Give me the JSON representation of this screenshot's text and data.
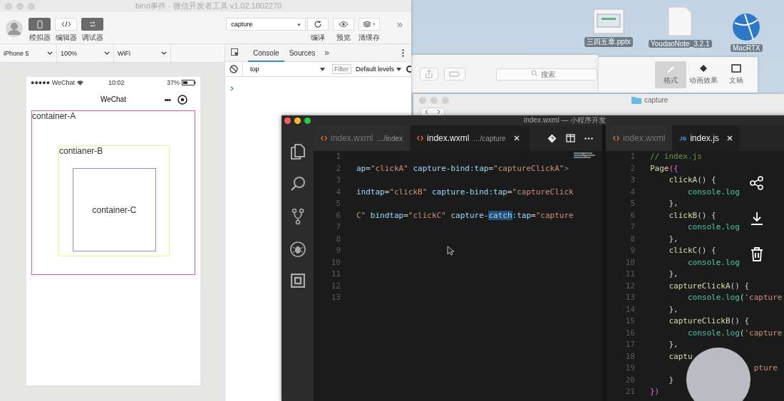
{
  "desktop": {
    "icons": [
      {
        "label": "三四五章.pptx",
        "kind": "slides"
      },
      {
        "label": "YoudaoNote_3.2.1",
        "kind": "document"
      },
      {
        "label": "MacRTX",
        "kind": "globe"
      }
    ]
  },
  "background_windows": {
    "search_placeholder": "搜索",
    "tools": [
      {
        "label": "格式",
        "kind": "brush",
        "selected": true
      },
      {
        "label": "动画效果",
        "kind": "diamond",
        "selected": false
      },
      {
        "label": "文稿",
        "kind": "doc",
        "selected": false
      }
    ],
    "finder_title": "capture"
  },
  "devtools": {
    "title": "bind事件 - 微信开发者工具 v1.02.1802270",
    "modes": [
      {
        "label": "模拟器",
        "kind": "phone",
        "selected": true
      },
      {
        "label": "编辑器",
        "kind": "code",
        "selected": false
      },
      {
        "label": "调试器",
        "kind": "debug",
        "selected": true
      }
    ],
    "project": "capture",
    "actions": [
      {
        "label": "编译",
        "kind": "refresh"
      },
      {
        "label": "预览",
        "kind": "eye"
      },
      {
        "label": "清缓存",
        "kind": "layers"
      }
    ],
    "more": "»",
    "device_selects": [
      "iPhone 5",
      "100%",
      "WiFi"
    ],
    "debugger": {
      "tabs": [
        {
          "label": "Console",
          "selected": true
        },
        {
          "label": "Sources",
          "selected": false
        }
      ],
      "more": "»",
      "context": "top",
      "filter_placeholder": "Filter",
      "levels": "Default levels"
    },
    "phone": {
      "carrier": "●●●●● WeChat",
      "time": "10:02",
      "battery": "37%",
      "nav_title": "WeChat",
      "menu": "•••",
      "containers": [
        {
          "label": "container-A",
          "color": "#e0607c"
        },
        {
          "label": "contianer-B",
          "color": "#f4f48a"
        },
        {
          "label": "container-C",
          "color": "#8c8cd8"
        }
      ]
    }
  },
  "editor": {
    "title": "index.wxml — 小程序开发",
    "groups": [
      {
        "tabs": [
          {
            "name": "index.wxml",
            "path": "…/index",
            "kind": "wxml",
            "selected": false
          },
          {
            "name": "index.wxml",
            "path": "…/capture",
            "kind": "wxml",
            "selected": true
          }
        ],
        "lines": [
          {
            "number": "1"
          },
          {
            "number": "2",
            "tokens": [
              {
                "text": "ap",
                "kind": "attr"
              },
              {
                "text": "=",
                "kind": "plain"
              },
              {
                "text": "\"clickA\"",
                "kind": "string"
              },
              {
                "text": " capture-bind:tap",
                "kind": "attr"
              },
              {
                "text": "=",
                "kind": "plain"
              },
              {
                "text": "\"captureClickA\"",
                "kind": "string"
              },
              {
                "text": ">",
                "kind": "tag"
              }
            ]
          },
          {
            "number": "3"
          },
          {
            "number": "4",
            "tokens": [
              {
                "text": "indtap",
                "kind": "attr"
              },
              {
                "text": "=",
                "kind": "plain"
              },
              {
                "text": "\"clickB\"",
                "kind": "string"
              },
              {
                "text": " capture-bind:tap",
                "kind": "attr"
              },
              {
                "text": "=",
                "kind": "plain"
              },
              {
                "text": "\"captureClick",
                "kind": "string"
              }
            ]
          },
          {
            "number": "5"
          },
          {
            "number": "6",
            "tokens": [
              {
                "text": "C\"",
                "kind": "string"
              },
              {
                "text": " bindtap",
                "kind": "attr"
              },
              {
                "text": "=",
                "kind": "plain"
              },
              {
                "text": "\"clickC\"",
                "kind": "string"
              },
              {
                "text": " capture-",
                "kind": "attr"
              },
              {
                "text": "catch",
                "kind": "selection"
              },
              {
                "text": ":tap",
                "kind": "attr"
              },
              {
                "text": "=",
                "kind": "plain"
              },
              {
                "text": "\"capture",
                "kind": "string"
              }
            ]
          },
          {
            "number": "7"
          },
          {
            "number": "8"
          },
          {
            "number": "9"
          },
          {
            "number": "10"
          },
          {
            "number": "11"
          },
          {
            "number": "12"
          },
          {
            "number": "13"
          }
        ]
      },
      {
        "tabs": [
          {
            "name": "index.wxml",
            "kind": "wxml",
            "selected": false
          },
          {
            "name": "index.js",
            "kind": "js",
            "badge": "JS",
            "selected": true
          }
        ],
        "lines": [
          {
            "number": "1",
            "tokens": [
              {
                "text": "// index.js",
                "kind": "comment"
              }
            ]
          },
          {
            "number": "2",
            "tokens": [
              {
                "text": "Page",
                "kind": "method"
              },
              {
                "text": "({",
                "kind": "bracket"
              }
            ]
          },
          {
            "number": "3",
            "tokens": [
              {
                "text": "    clickA",
                "kind": "method"
              },
              {
                "text": "() {",
                "kind": "plain"
              }
            ]
          },
          {
            "number": "4",
            "tokens": [
              {
                "text": "        console.log",
                "kind": "console"
              }
            ]
          },
          {
            "number": "5",
            "tokens": [
              {
                "text": "    },",
                "kind": "plain"
              }
            ]
          },
          {
            "number": "6",
            "tokens": [
              {
                "text": "    clickB",
                "kind": "method"
              },
              {
                "text": "() {",
                "kind": "plain"
              }
            ]
          },
          {
            "number": "7",
            "tokens": [
              {
                "text": "        console.log",
                "kind": "console"
              }
            ]
          },
          {
            "number": "8",
            "tokens": [
              {
                "text": "    },",
                "kind": "plain"
              }
            ]
          },
          {
            "number": "9",
            "tokens": [
              {
                "text": "    clickC",
                "kind": "method"
              },
              {
                "text": "() {",
                "kind": "plain"
              }
            ]
          },
          {
            "number": "10",
            "tokens": [
              {
                "text": "        console.log",
                "kind": "console"
              }
            ]
          },
          {
            "number": "11",
            "tokens": [
              {
                "text": "    },",
                "kind": "plain"
              }
            ]
          },
          {
            "number": "12",
            "tokens": [
              {
                "text": "    captureClickA",
                "kind": "method"
              },
              {
                "text": "() {",
                "kind": "plain"
              }
            ]
          },
          {
            "number": "13",
            "tokens": [
              {
                "text": "        console.log",
                "kind": "console"
              },
              {
                "text": "(",
                "kind": "plain"
              },
              {
                "text": "'capture",
                "kind": "string"
              }
            ]
          },
          {
            "number": "14",
            "tokens": [
              {
                "text": "    },",
                "kind": "plain"
              }
            ]
          },
          {
            "number": "15",
            "tokens": [
              {
                "text": "    captureClickB",
                "kind": "method"
              },
              {
                "text": "() {",
                "kind": "plain"
              }
            ]
          },
          {
            "number": "16",
            "tokens": [
              {
                "text": "        console.log",
                "kind": "console"
              },
              {
                "text": "(",
                "kind": "plain"
              },
              {
                "text": "'capture",
                "kind": "string"
              }
            ]
          },
          {
            "number": "17",
            "tokens": [
              {
                "text": "    },",
                "kind": "plain"
              }
            ]
          },
          {
            "number": "18",
            "tokens": [
              {
                "text": "    captu",
                "kind": "method"
              }
            ]
          },
          {
            "number": "19",
            "tokens": [
              {
                "text": "                      pture",
                "kind": "string"
              }
            ]
          },
          {
            "number": "20",
            "tokens": [
              {
                "text": "    }",
                "kind": "plain"
              }
            ]
          },
          {
            "number": "21",
            "tokens": [
              {
                "text": "})",
                "kind": "bracket"
              }
            ]
          }
        ]
      }
    ]
  }
}
